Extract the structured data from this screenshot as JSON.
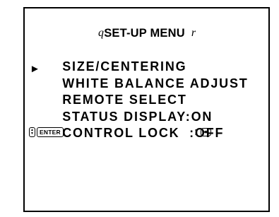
{
  "menu": {
    "title": "SET-UP MENU",
    "corner_left": "q",
    "corner_right": "r",
    "cursor": "►",
    "items": [
      {
        "label": "SIZE/CENTERING",
        "value": ""
      },
      {
        "label": "WHITE BALANCE ADJUST",
        "value": ""
      },
      {
        "label": "REMOTE SELECT",
        "value": ""
      },
      {
        "label": "STATUS DISPLAY",
        "value": ":ON"
      },
      {
        "label": "CONTROL LOCK  ",
        "value": ":OFF"
      }
    ],
    "selected_item": "WHITE BALANCE ADJUST"
  },
  "guide": {
    "updown_icon": "up-down-arrows-icon",
    "enter_label": "ENTER",
    "separator": ":",
    "leftright_icon": "left-right-arrows-icon"
  },
  "colors": {
    "background": "#ffffff",
    "foreground": "#000000"
  }
}
